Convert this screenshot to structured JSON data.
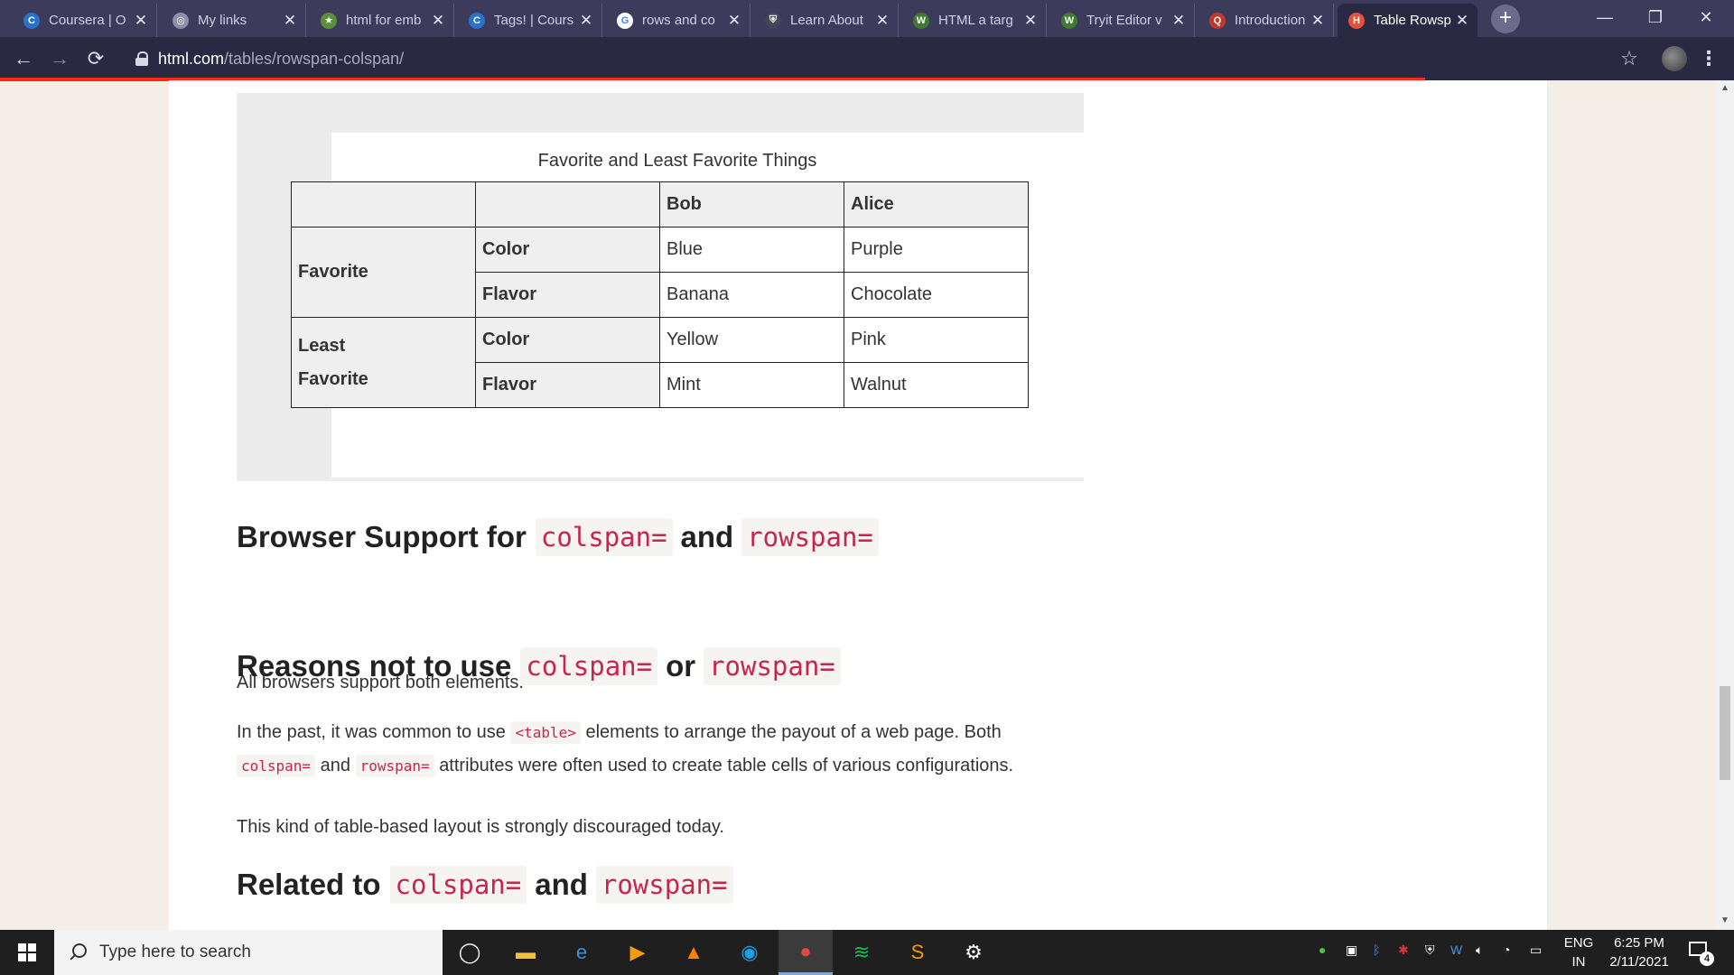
{
  "browser": {
    "tabs": [
      {
        "title": "Coursera | O",
        "favicon": "coursera-icon",
        "color": "#2a73cc",
        "glyph": "C"
      },
      {
        "title": "My links",
        "favicon": "globe-icon",
        "color": "#8e8ea8",
        "glyph": "◎"
      },
      {
        "title": "html for emb",
        "favicon": "bookmark-star-icon",
        "color": "#5b8f3a",
        "glyph": "★"
      },
      {
        "title": "Tags! | Cours",
        "favicon": "coursera-icon",
        "color": "#2a73cc",
        "glyph": "C"
      },
      {
        "title": "rows and co",
        "favicon": "google-icon",
        "color": "#ffffff",
        "glyph": "G"
      },
      {
        "title": "Learn About",
        "favicon": "shield-icon",
        "color": "#444455",
        "glyph": "⛨"
      },
      {
        "title": "HTML a targ",
        "favicon": "w3schools-icon",
        "color": "#3e7a2f",
        "glyph": "W"
      },
      {
        "title": "Tryit Editor v",
        "favicon": "w3schools-icon",
        "color": "#3e7a2f",
        "glyph": "W"
      },
      {
        "title": "Introduction",
        "favicon": "circle-q-icon",
        "color": "#c0392b",
        "glyph": "Q"
      },
      {
        "title": "Table Rowsp",
        "favicon": "html-com-icon",
        "color": "#e4513c",
        "glyph": "H",
        "active": true
      }
    ],
    "url_host": "html.com",
    "url_path": "/tables/rowspan-colspan/",
    "loading_color": "#ff2a1a"
  },
  "example": {
    "caption": "Favorite and Least Favorite Things",
    "header": [
      "",
      "",
      "Bob",
      "Alice"
    ],
    "groups": [
      {
        "label": "Favorite",
        "rows": [
          {
            "attr": "Color",
            "bob": "Blue",
            "alice": "Purple"
          },
          {
            "attr": "Flavor",
            "bob": "Banana",
            "alice": "Chocolate"
          }
        ]
      },
      {
        "label_line1": "Least",
        "label_line2": "Favorite",
        "rows": [
          {
            "attr": "Color",
            "bob": "Yellow",
            "alice": "Pink"
          },
          {
            "attr": "Flavor",
            "bob": "Mint",
            "alice": "Walnut"
          }
        ]
      }
    ]
  },
  "sections": {
    "browser_support": {
      "t1": "Browser Support for",
      "c1": "colspan=",
      "t2": "and",
      "c2": "rowspan="
    },
    "support_text": "All browsers support both elements.",
    "reasons": {
      "t1": "Reasons not to use",
      "c1": "colspan=",
      "t2": "or",
      "c2": "rowspan="
    },
    "reasons_p1": {
      "a": "In the past, it was common to use",
      "code_table": "<table>",
      "b": "elements to arrange the payout of a web page. Both",
      "code_colspan": "colspan=",
      "c": "and",
      "code_rowspan": "rowspan=",
      "d": "attributes were often used to create table cells of various configurations."
    },
    "reasons_p2": "This kind of table-based layout is strongly discouraged today.",
    "related": {
      "t1": "Related to",
      "c1": "colspan=",
      "t2": "and",
      "c2": "rowspan="
    }
  },
  "taskbar": {
    "search_placeholder": "Type here to search",
    "pinned": [
      "task-view-icon",
      "file-explorer-icon",
      "internet-explorer-icon",
      "media-player-icon",
      "vlc-icon",
      "edge-icon",
      "chrome-icon",
      "spotify-icon",
      "sublime-text-icon",
      "settings-icon"
    ],
    "lang_line1": "ENG",
    "lang_line2": "IN",
    "time": "6:25 PM",
    "date": "2/11/2021",
    "notification_count": "4"
  }
}
